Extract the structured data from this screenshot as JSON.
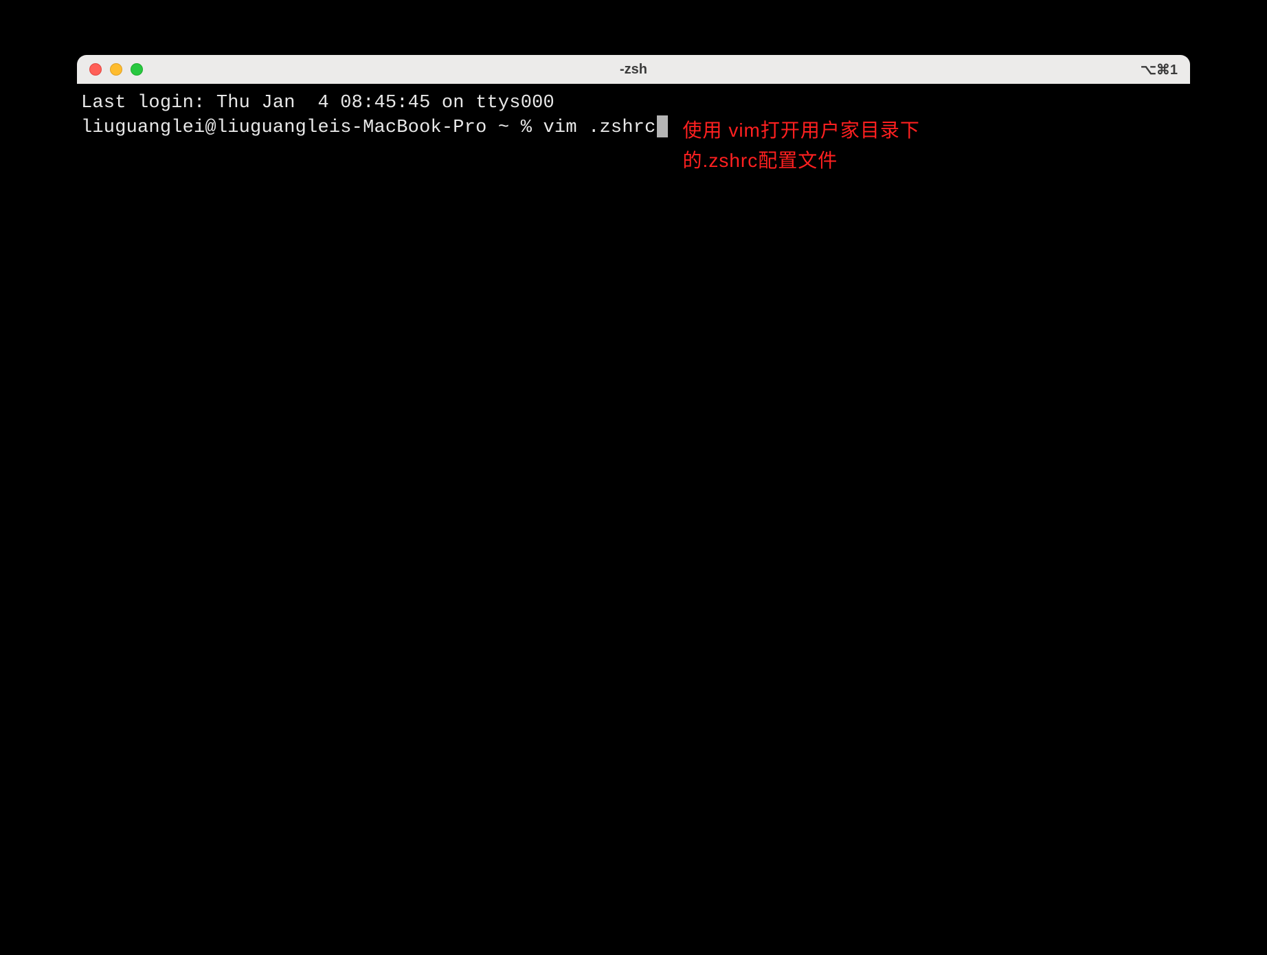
{
  "window": {
    "title": "-zsh",
    "shortcut": "⌥⌘1"
  },
  "terminal": {
    "login_line": "Last login: Thu Jan  4 08:45:45 on ttys000",
    "prompt": "liuguanglei@liuguangleis-MacBook-Pro ~ % ",
    "command": "vim .zshrc"
  },
  "annotation": {
    "text": "使用 vim打开用户家目录下的.zshrc配置文件"
  }
}
